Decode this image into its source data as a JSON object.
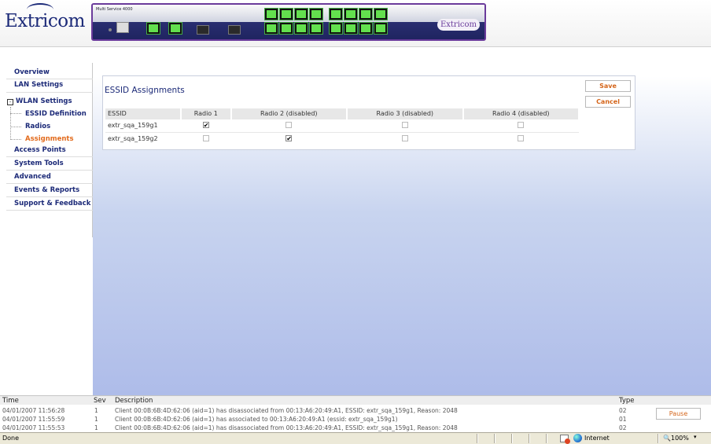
{
  "header": {
    "logo_text": "Extricom",
    "device_model": "Multi Service 4000",
    "device_logo": "Extricom"
  },
  "sidebar": {
    "items": [
      {
        "label": "Overview"
      },
      {
        "label": "LAN Settings"
      },
      {
        "label": "WLAN Settings",
        "expander": "-"
      },
      {
        "label": "ESSID Definition"
      },
      {
        "label": "Radios"
      },
      {
        "label": "Assignments",
        "active": true
      },
      {
        "label": "Access Points"
      },
      {
        "label": "System Tools"
      },
      {
        "label": "Advanced"
      },
      {
        "label": "Events & Reports"
      },
      {
        "label": "Support & Feedback"
      }
    ]
  },
  "main": {
    "title": "ESSID Assignments",
    "save_label": "Save",
    "cancel_label": "Cancel",
    "columns": [
      "ESSID",
      "Radio 1",
      "Radio 2 (disabled)",
      "Radio 3 (disabled)",
      "Radio 4 (disabled)"
    ],
    "rows": [
      {
        "essid": "extr_sqa_159g1",
        "checks": [
          true,
          false,
          false,
          false
        ],
        "enabled": [
          true,
          false,
          false,
          false
        ]
      },
      {
        "essid": "extr_sqa_159g2",
        "checks": [
          false,
          true,
          false,
          false
        ],
        "enabled": [
          false,
          true,
          false,
          false
        ]
      }
    ]
  },
  "log": {
    "headers": {
      "time": "Time",
      "sev": "Sev",
      "description": "Description",
      "type": "Type"
    },
    "rows": [
      {
        "time": "04/01/2007 11:56:28",
        "sev": "1",
        "description": "Client 00:0B:6B:4D:62:06 (aid=1) has disassociated from 00:13:A6:20:49:A1, ESSID: extr_sqa_159g1, Reason: 2048",
        "type": "02"
      },
      {
        "time": "04/01/2007 11:55:59",
        "sev": "1",
        "description": "Client 00:0B:6B:4D:62:06 (aid=1) has associated to 00:13:A6:20:49:A1 (essid: extr_sqa_159g1)",
        "type": "01"
      },
      {
        "time": "04/01/2007 11:55:53",
        "sev": "1",
        "description": "Client 00:0B:6B:4D:62:06 (aid=1) has disassociated from 00:13:A6:20:49:A1, ESSID: extr_sqa_159g1, Reason: 2048",
        "type": "02"
      }
    ],
    "pause_label": "Pause"
  },
  "statusbar": {
    "text": "Done",
    "zone": "Internet",
    "zoom": "100%"
  },
  "colors": {
    "nav": "#1c2a78",
    "active": "#e26b1d",
    "button_text": "#d4651a",
    "device_border": "#6a3b9b"
  }
}
